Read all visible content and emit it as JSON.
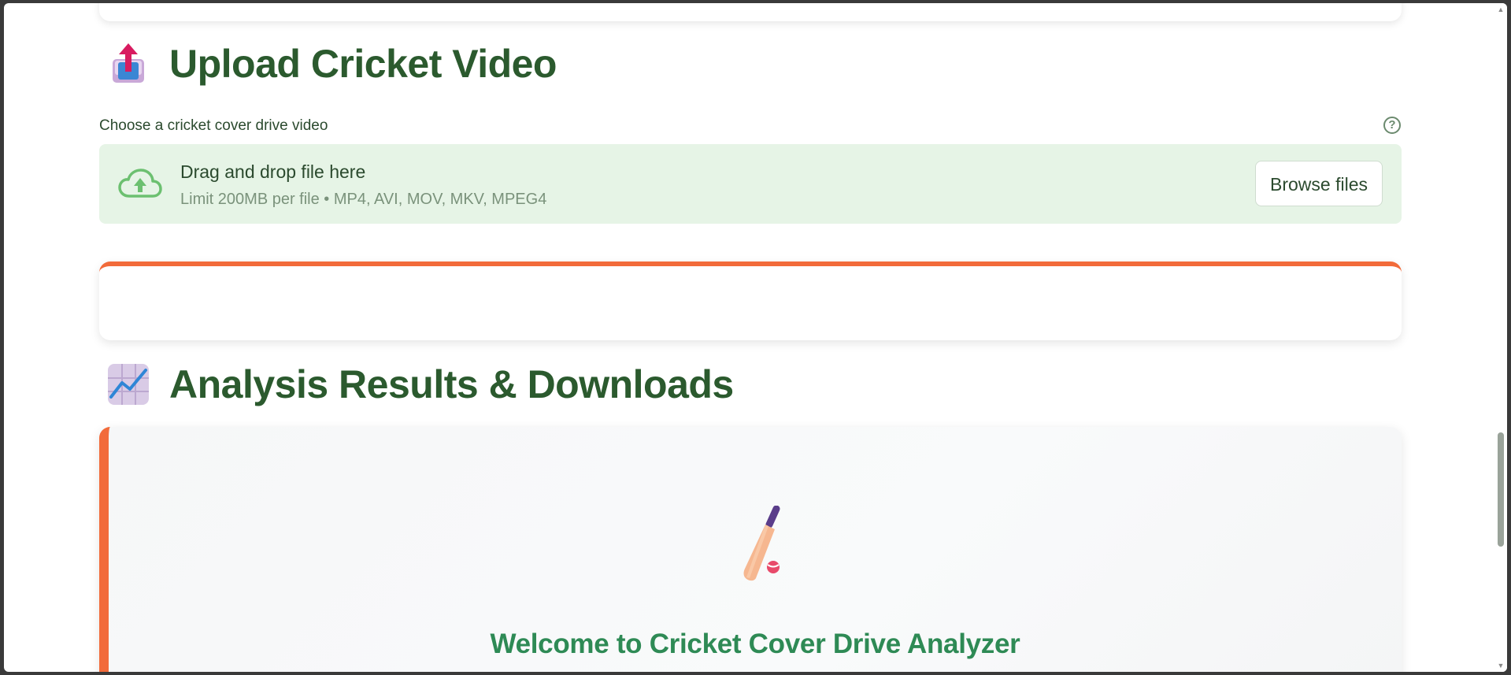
{
  "upload_section": {
    "title": "Upload Cricket Video",
    "icon": "outbox-tray-icon",
    "label": "Choose a cricket cover drive video",
    "dropzone": {
      "title": "Drag and drop file here",
      "limit": "Limit 200MB per file • MP4, AVI, MOV, MKV, MPEG4",
      "browse_label": "Browse files"
    }
  },
  "analysis_section": {
    "title": "Analysis Results & Downloads",
    "icon": "chart-increasing-icon",
    "welcome_title": "Welcome to Cricket Cover Drive Analyzer",
    "welcome_icon": "cricket-bat-ball-icon"
  },
  "colors": {
    "heading": "#2b5a2e",
    "accent": "#f26b3a",
    "dropzone_bg": "#e6f4e6",
    "welcome_title": "#2e8a55"
  }
}
